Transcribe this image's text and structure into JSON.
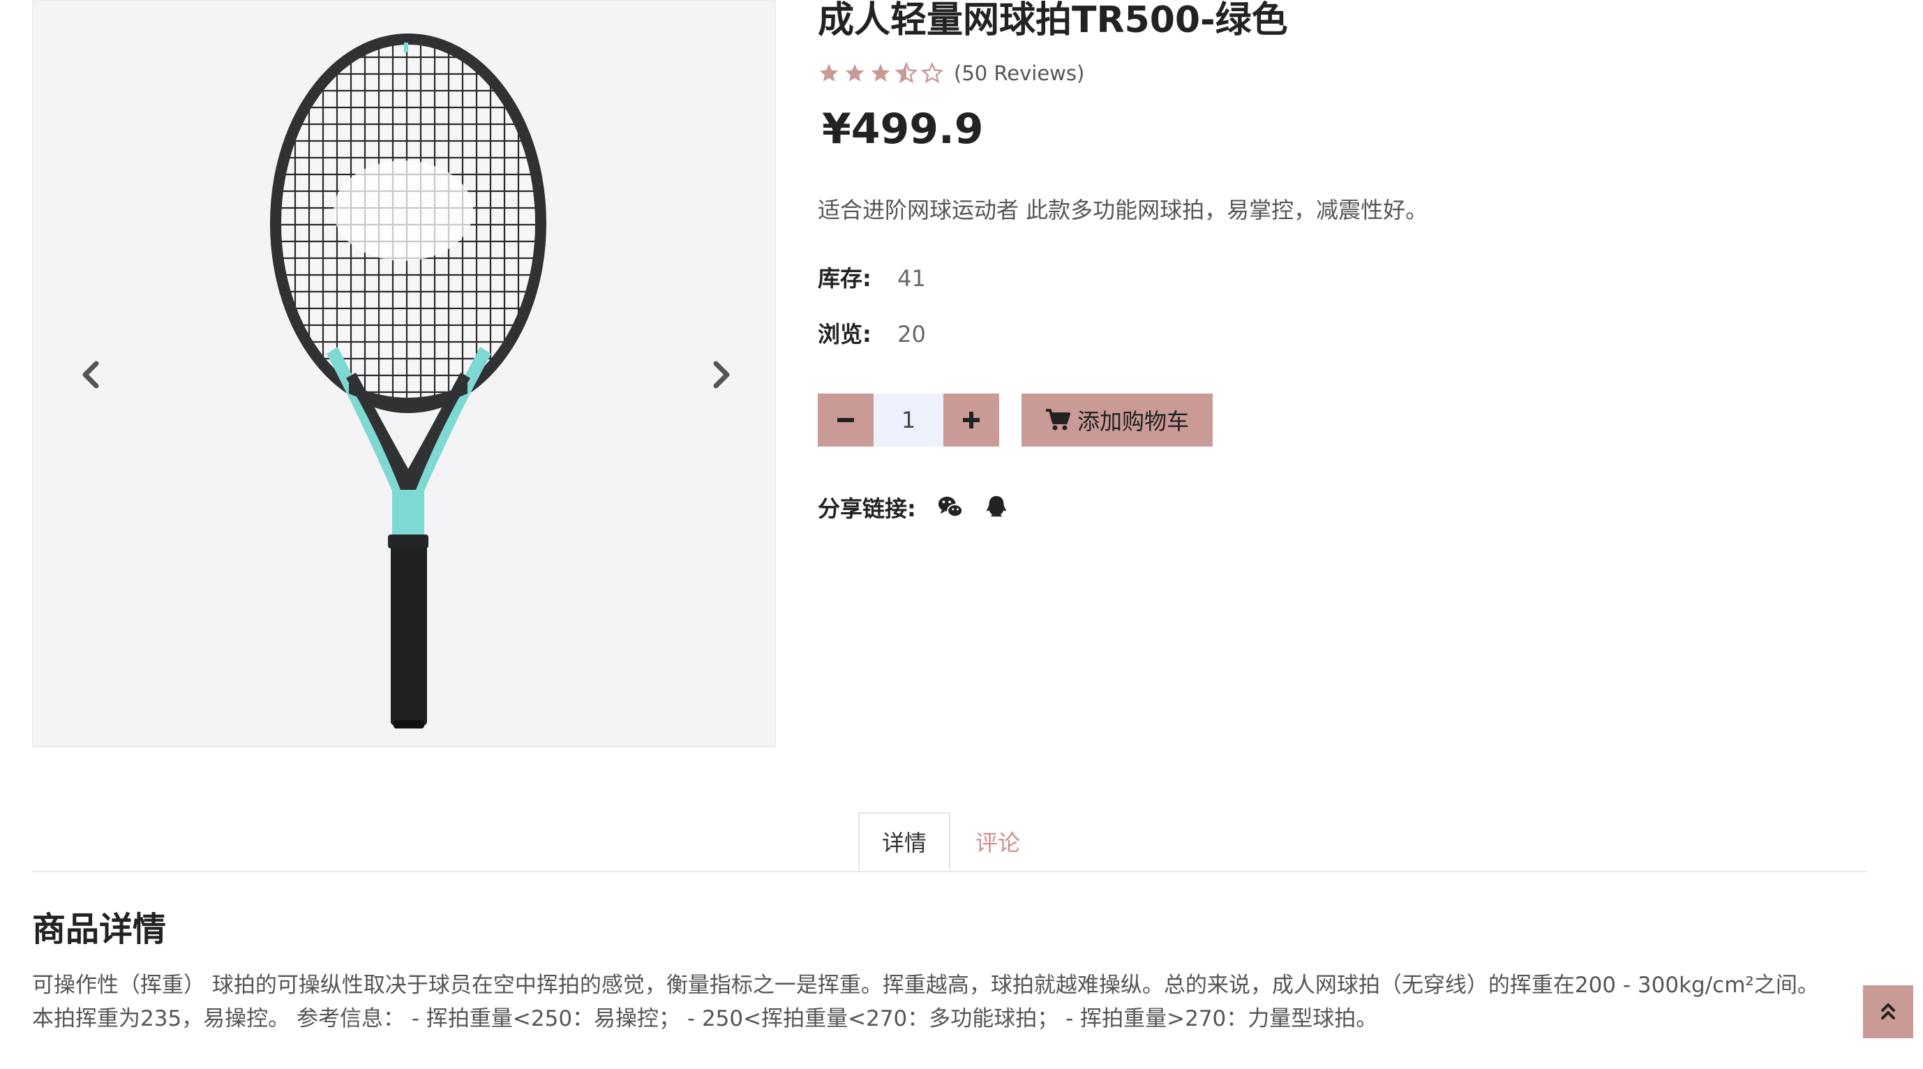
{
  "product": {
    "title": "成人轻量网球拍TR500-绿色",
    "rating": 3.5,
    "rating_max": 5,
    "reviews_text": "(50 Reviews)",
    "price": "¥499.9",
    "description": "适合进阶网球运动者 此款多功能网球拍，易掌控，减震性好。",
    "stock_label": "库存:",
    "stock_value": "41",
    "views_label": "浏览:",
    "views_value": "20",
    "quantity": "1",
    "add_to_cart_label": "添加购物车",
    "share_label": "分享链接:",
    "share_icons": [
      "wechat-icon",
      "qq-icon"
    ]
  },
  "gallery": {
    "image_subject": "tennis racket black and mint green",
    "prev_icon": "chevron-left-icon",
    "next_icon": "chevron-right-icon"
  },
  "tabs": [
    {
      "label": "详情",
      "active": true
    },
    {
      "label": "评论",
      "active": false
    }
  ],
  "detail": {
    "title": "商品详情",
    "text": "可操作性（挥重） 球拍的可操纵性取决于球员在空中挥拍的感觉，衡量指标之一是挥重。挥重越高，球拍就越难操纵。总的来说，成人网球拍（无穿线）的挥重在200 - 300kg/cm²之间。 本拍挥重为235，易操控。 参考信息： - 挥拍重量<250：易操控； - 250<挥拍重量<270：多功能球拍； - 挥拍重量>270：力量型球拍。"
  },
  "colors": {
    "accent": "#c99a96",
    "tab_inactive": "#d08f8f",
    "star": "#c99a96",
    "qty_bg": "#eef1fb"
  }
}
